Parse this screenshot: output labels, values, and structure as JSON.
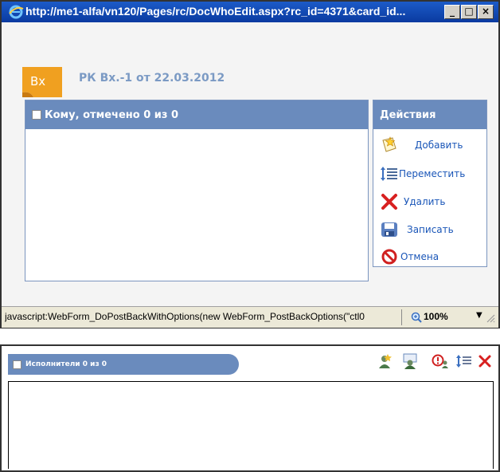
{
  "window": {
    "title": "http://me1-alfa/vn120/Pages/rc/DocWhoEdit.aspx?rc_id=4371&card_id...",
    "minimize_label": "_",
    "maximize_label": "□",
    "close_label": "×"
  },
  "document": {
    "badge_text": "Вх",
    "title": "РК Вх.-1 от 22.03.2012"
  },
  "recipients_panel": {
    "header_label": "Кому, отмечено 0 из 0"
  },
  "actions": {
    "title": "Действия",
    "items": [
      {
        "label": "Добавить",
        "icon": "add-icon"
      },
      {
        "label": "Переместить",
        "icon": "move-icon"
      },
      {
        "label": "Удалить",
        "icon": "delete-icon"
      },
      {
        "label": "Записать",
        "icon": "save-icon"
      },
      {
        "label": "Отмена",
        "icon": "cancel-icon"
      }
    ]
  },
  "statusbar": {
    "text": "javascript:WebForm_DoPostBackWithOptions(new WebForm_PostBackOptions(\"ctl0",
    "zoom": "100%"
  },
  "executors_panel": {
    "tab_label": "Исполнители 0 из 0",
    "toolbar_icons": [
      "add-user-icon",
      "user-calendar-icon",
      "alert-user-icon",
      "move-list-icon",
      "delete-icon"
    ]
  },
  "colors": {
    "header_blue": "#6a8bbd",
    "link_blue": "#1a56b8",
    "title_gray_blue": "#7b9ac4",
    "badge_orange": "#f0a020"
  }
}
